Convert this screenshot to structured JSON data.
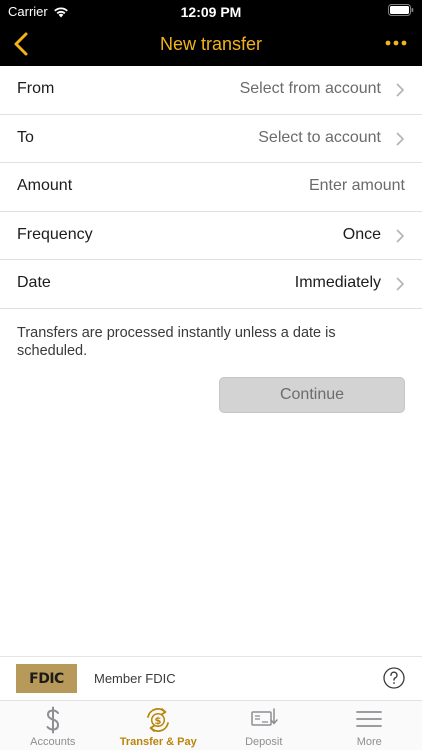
{
  "status": {
    "carrier": "Carrier",
    "time": "12:09 PM"
  },
  "nav": {
    "title": "New transfer",
    "back_icon": "chevron-left-icon",
    "more_icon": "ellipsis-icon",
    "accent": "#f2b41b"
  },
  "form": {
    "rows": [
      {
        "label": "From",
        "value": "Select from account",
        "placeholder": true,
        "arrow": true
      },
      {
        "label": "To",
        "value": "Select to account",
        "placeholder": true,
        "arrow": true
      },
      {
        "label": "Amount",
        "value": "Enter amount",
        "placeholder": true,
        "arrow": false
      },
      {
        "label": "Frequency",
        "value": "Once",
        "placeholder": false,
        "arrow": true
      },
      {
        "label": "Date",
        "value": "Immediately",
        "placeholder": false,
        "arrow": true
      }
    ],
    "note": "Transfers are processed instantly unless a date is scheduled.",
    "continue_label": "Continue"
  },
  "footer": {
    "logo_text": "FDIC",
    "member_text": "Member FDIC",
    "help_icon": "question-circle-icon"
  },
  "tabs": [
    {
      "label": "Accounts",
      "icon": "dollar-icon",
      "active": false
    },
    {
      "label": "Transfer & Pay",
      "icon": "transfer-dollar-icon",
      "active": true
    },
    {
      "label": "Deposit",
      "icon": "check-deposit-icon",
      "active": false
    },
    {
      "label": "More",
      "icon": "menu-icon",
      "active": false
    }
  ]
}
